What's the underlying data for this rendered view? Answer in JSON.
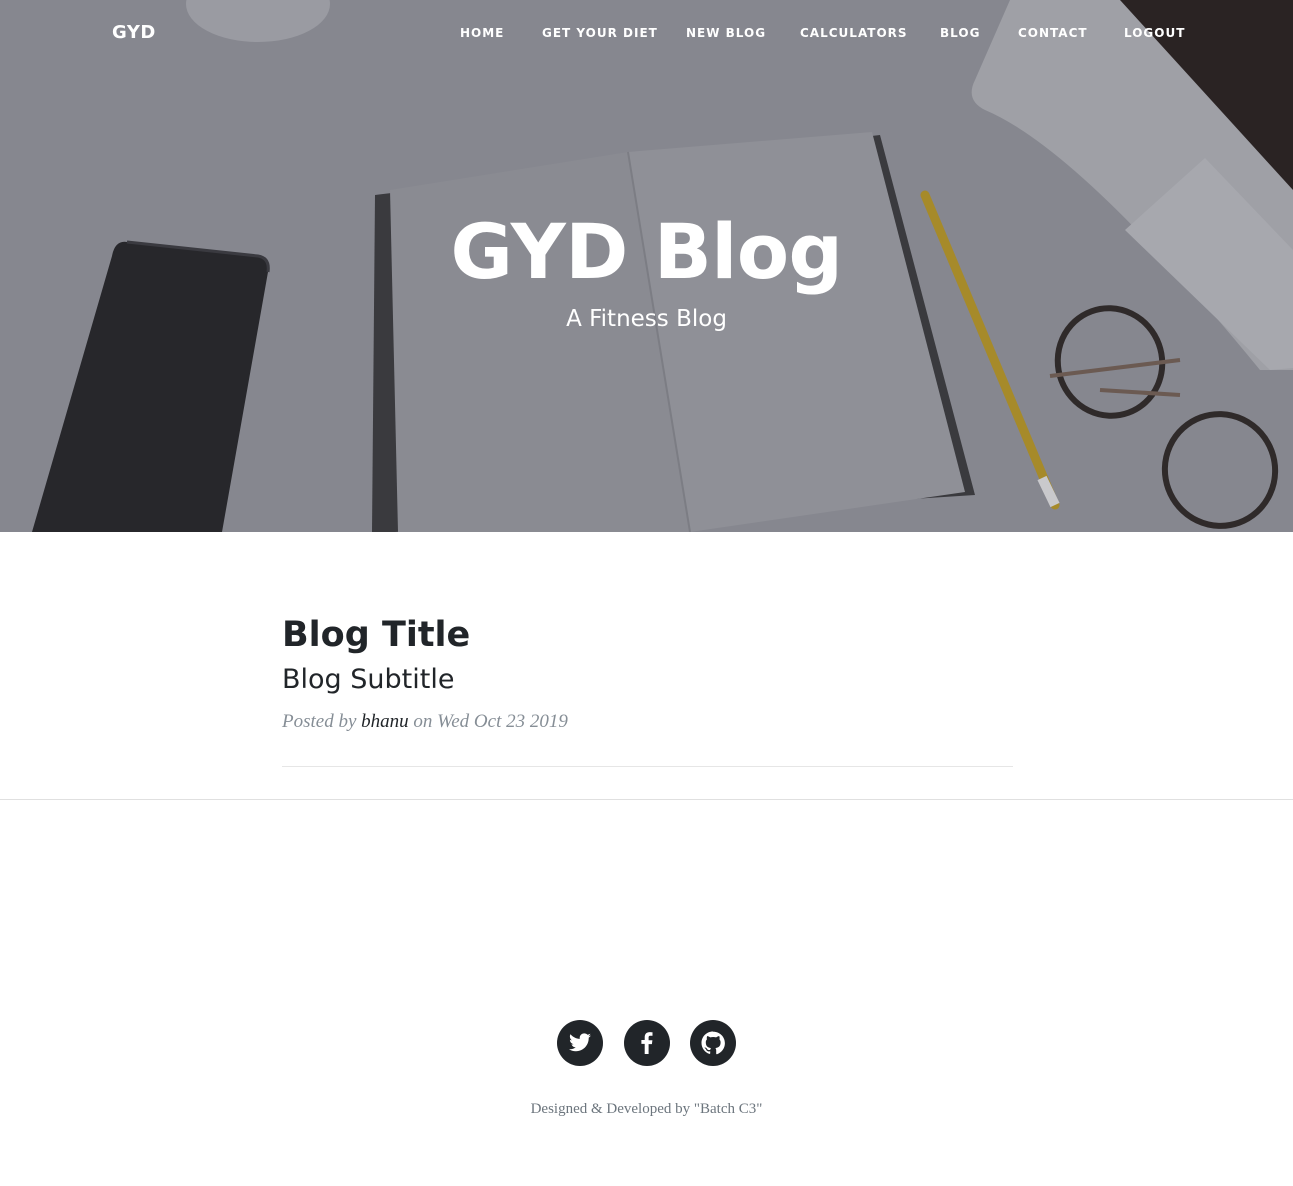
{
  "nav": {
    "brand": "GYD",
    "links": [
      "HOME",
      "GET YOUR DIET",
      "NEW BLOG",
      "CALCULATORS",
      "BLOG",
      "CONTACT",
      "LOGOUT"
    ]
  },
  "hero": {
    "title": "GYD Blog",
    "subtitle": "A Fitness Blog"
  },
  "post": {
    "title": "Blog Title",
    "subtitle": "Blog Subtitle",
    "meta_prefix": "Posted by",
    "author": "bhanu",
    "meta_on": "on",
    "date": "Wed Oct 23 2019"
  },
  "footer": {
    "social_icons": [
      "twitter-icon",
      "facebook-icon",
      "github-icon"
    ],
    "credit": "Designed & Developed by \"Batch C3\""
  },
  "colors": {
    "hero_overlay": "#868890",
    "text_dark": "#212529",
    "meta_gray": "#868e96"
  }
}
